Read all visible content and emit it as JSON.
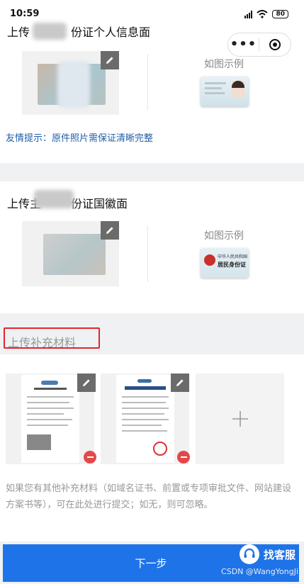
{
  "status_bar": {
    "time": "10:59",
    "battery": "80"
  },
  "capsule": {
    "more_icon": "more-dots-icon",
    "close_icon": "target-circle-icon"
  },
  "front_section": {
    "title_prefix": "上传",
    "title_suffix": "份证个人信息面",
    "example_label": "如图示例",
    "tip": "友情提示：原件照片需保证清晰完整"
  },
  "emblem_section": {
    "title_prefix": "上传主",
    "title_suffix": "份证国徽面",
    "example_label": "如图示例",
    "example_card_line1": "中华人民共和国",
    "example_card_line2": "居民身份证"
  },
  "supplement": {
    "title": "上传补充材料",
    "note": "如果您有其他补充材料（如域名证书、前置或专项审批文件、网站建设方案书等），可在此处进行提交；如无，则可忽略。",
    "add_icon": "plus-icon"
  },
  "footer": {
    "next_label": "下一步",
    "service_label": "找客服",
    "watermark": "CSDN @WangYongJi"
  },
  "colors": {
    "accent": "#1f73e8",
    "tip": "#1f5fa8",
    "highlight": "#e0252f",
    "remove": "#e34848"
  }
}
